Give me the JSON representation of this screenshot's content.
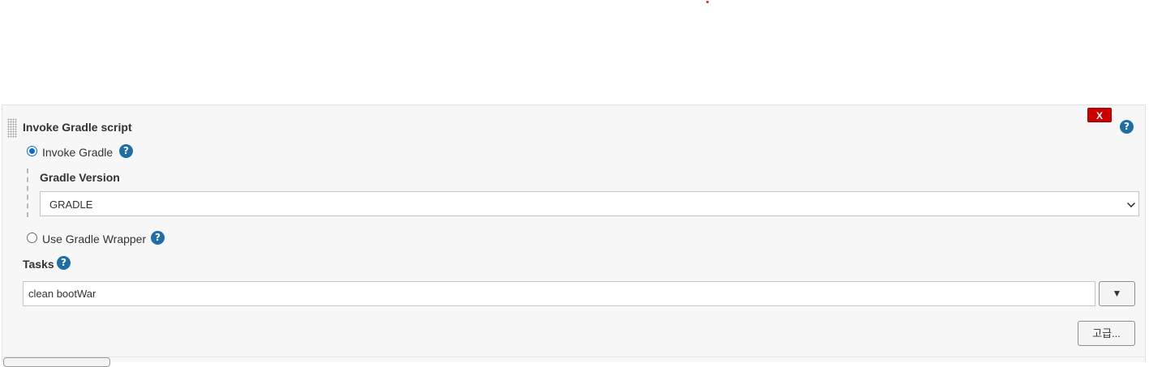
{
  "build_step": {
    "title": "Invoke Gradle script",
    "delete_label": "X",
    "help_glyph": "?",
    "invoke_gradle": {
      "label": "Invoke Gradle",
      "checked": true,
      "gradle_version": {
        "label": "Gradle Version",
        "selected": "GRADLE"
      }
    },
    "use_wrapper": {
      "label": "Use Gradle Wrapper",
      "checked": false
    },
    "tasks": {
      "label": "Tasks",
      "value": "clean bootWar",
      "expand_glyph": "▼"
    },
    "advanced_label": "고급..."
  },
  "colors": {
    "delete_button": "#cc0000",
    "help_icon": "#1f6ea8",
    "panel_background": "#f7f7f7",
    "radio_selected": "#0a6bd6"
  },
  "icons": {
    "help": "question-circle-icon",
    "drag": "drag-handle-icon",
    "expand": "triangle-down-icon",
    "dropdown": "chevron-down-icon"
  }
}
